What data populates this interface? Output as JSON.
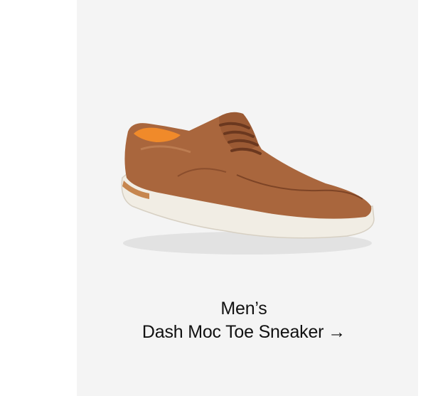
{
  "product": {
    "gender_label": "Men’s",
    "name": "Dash Moc Toe Sneaker",
    "arrow": "→",
    "image_icon": "sneaker-image"
  },
  "colors": {
    "card_background": "#f4f4f4",
    "leather": "#a9663d",
    "sole": "#f1ede4",
    "lining": "#f08a2a",
    "text": "#111111"
  }
}
